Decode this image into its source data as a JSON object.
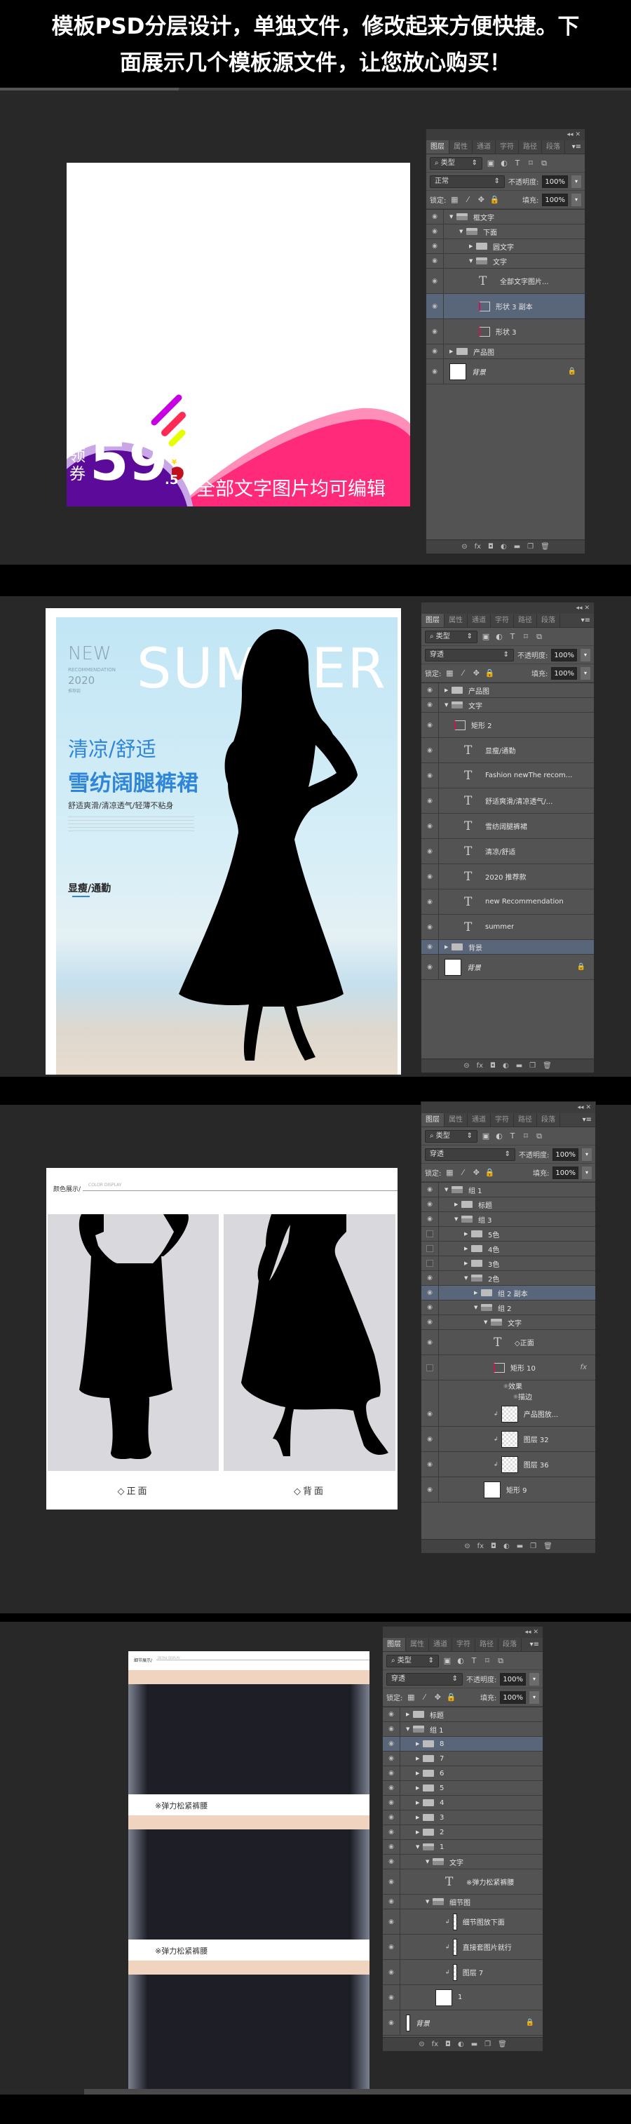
{
  "header": {
    "line1": "模板PSD分层设计，单独文件，修改起来方便快捷。下",
    "line2": "面展示几个模板源文件，让您放心购买！"
  },
  "colors": {
    "purple": "#5b0a9a",
    "pink": "#ff2a7a",
    "blue_text": "#2f86d8",
    "panel": "#535353",
    "selected_row": "#596578",
    "page_bg": "#282828"
  },
  "panel_common": {
    "collapse": "◂◂",
    "close": "✕",
    "tabs": [
      "图层",
      "属性",
      "通道",
      "字符",
      "路径",
      "段落"
    ],
    "menu": "▾≡",
    "filter_label": "⌕ 类型",
    "opacity_label": "不透明度:",
    "opacity": "100%",
    "lock_label": "锁定:",
    "fill_label": "填充:",
    "fill": "100%",
    "bottom_icons": [
      "⊝",
      "fx",
      "◘",
      "◐",
      "▬",
      "❐",
      "🗑"
    ]
  },
  "panels": [
    {
      "blend": "正常",
      "layers": [
        {
          "name": "框文字",
          "indent": 0,
          "type": "folder-open"
        },
        {
          "name": "下面",
          "indent": 1,
          "type": "folder-open"
        },
        {
          "name": "圆文字",
          "indent": 2,
          "type": "folder"
        },
        {
          "name": "文字",
          "indent": 2,
          "type": "folder-open"
        },
        {
          "name": "全部文字图片...",
          "indent": 3,
          "type": "text",
          "tall": true
        },
        {
          "name": "形状 3 副本",
          "indent": 3,
          "type": "shape",
          "tall": true,
          "selected": true
        },
        {
          "name": "形状 3",
          "indent": 3,
          "type": "shape",
          "tall": true
        },
        {
          "name": "产品图",
          "indent": 0,
          "type": "folder"
        },
        {
          "name": "背景",
          "indent": 0,
          "type": "thumb-white",
          "tall": true,
          "italic": true,
          "locked": true
        }
      ]
    },
    {
      "blend": "穿透",
      "layers": [
        {
          "name": "产品图",
          "indent": 0,
          "type": "folder"
        },
        {
          "name": "文字",
          "indent": 0,
          "type": "folder-open"
        },
        {
          "name": "矩形 2",
          "indent": 1,
          "type": "shape",
          "tall": true
        },
        {
          "name": "显瘦/通勤",
          "indent": 2,
          "type": "text",
          "tall": true
        },
        {
          "name": "Fashion newThe recom...",
          "indent": 2,
          "type": "text",
          "tall": true
        },
        {
          "name": "舒适爽滑/清凉透气/...",
          "indent": 2,
          "type": "text",
          "tall": true
        },
        {
          "name": "雪纺阔腿裤裙",
          "indent": 2,
          "type": "text",
          "tall": true
        },
        {
          "name": "清凉/舒适",
          "indent": 2,
          "type": "text",
          "tall": true
        },
        {
          "name": "2020 推荐款",
          "indent": 2,
          "type": "text",
          "tall": true
        },
        {
          "name": "new Recommendation",
          "indent": 2,
          "type": "text",
          "tall": true
        },
        {
          "name": "summer",
          "indent": 2,
          "type": "text",
          "tall": true
        },
        {
          "name": "背景",
          "indent": 0,
          "type": "folder",
          "selected": true
        },
        {
          "name": "背景",
          "indent": 0,
          "type": "thumb-white",
          "tall": true,
          "italic": true,
          "locked": true
        }
      ]
    },
    {
      "blend": "穿透",
      "layers": [
        {
          "name": "组 1",
          "indent": 0,
          "type": "folder-open"
        },
        {
          "name": "标题",
          "indent": 1,
          "type": "folder"
        },
        {
          "name": "组 3",
          "indent": 1,
          "type": "folder-open"
        },
        {
          "name": "5色",
          "indent": 2,
          "type": "folder",
          "hidden": true
        },
        {
          "name": "4色",
          "indent": 2,
          "type": "folder",
          "hidden": true
        },
        {
          "name": "3色",
          "indent": 2,
          "type": "folder",
          "hidden": true
        },
        {
          "name": "2色",
          "indent": 2,
          "type": "folder-open"
        },
        {
          "name": "组 2 副本",
          "indent": 3,
          "type": "folder",
          "selected": true
        },
        {
          "name": "组 2",
          "indent": 3,
          "type": "folder-open"
        },
        {
          "name": "文字",
          "indent": 4,
          "type": "folder-open"
        },
        {
          "name": "◇正面",
          "indent": 5,
          "type": "text",
          "tall": true
        },
        {
          "name": "矩形 10",
          "indent": 5,
          "type": "shape",
          "tall": true,
          "hidden": true,
          "fx": "fx"
        },
        {
          "name": "效果",
          "indent": 6,
          "type": "effect"
        },
        {
          "name": "描边",
          "indent": 7,
          "type": "effect"
        },
        {
          "name": "产品图放...",
          "indent": 5,
          "type": "thumb",
          "tall": true,
          "clip": true
        },
        {
          "name": "图层 32",
          "indent": 5,
          "type": "thumb",
          "tall": true,
          "clip": true
        },
        {
          "name": "图层 36",
          "indent": 5,
          "type": "thumb",
          "tall": true,
          "clip": true
        },
        {
          "name": "矩形 9",
          "indent": 4,
          "type": "thumb-white",
          "tall": true
        }
      ]
    },
    {
      "blend": "穿透",
      "layers": [
        {
          "name": "标题",
          "indent": 0,
          "type": "folder"
        },
        {
          "name": "组 1",
          "indent": 0,
          "type": "folder-open"
        },
        {
          "name": "8",
          "indent": 1,
          "type": "folder",
          "selected": true
        },
        {
          "name": "7",
          "indent": 1,
          "type": "folder"
        },
        {
          "name": "6",
          "indent": 1,
          "type": "folder"
        },
        {
          "name": "5",
          "indent": 1,
          "type": "folder"
        },
        {
          "name": "4",
          "indent": 1,
          "type": "folder"
        },
        {
          "name": "3",
          "indent": 1,
          "type": "folder"
        },
        {
          "name": "2",
          "indent": 1,
          "type": "folder"
        },
        {
          "name": "1",
          "indent": 1,
          "type": "folder-open"
        },
        {
          "name": "文字",
          "indent": 2,
          "type": "folder-open"
        },
        {
          "name": "※弹力松紧裤腰",
          "indent": 4,
          "type": "text",
          "tall": true
        },
        {
          "name": "细节图",
          "indent": 2,
          "type": "folder-open"
        },
        {
          "name": "细节图放下面",
          "indent": 4,
          "type": "thumb-slim",
          "tall": true,
          "clip": true
        },
        {
          "name": "直接套图片就行",
          "indent": 4,
          "type": "thumb-slim",
          "tall": true,
          "clip": true
        },
        {
          "name": "图层 7",
          "indent": 4,
          "type": "thumb-slim",
          "tall": true,
          "clip": true
        },
        {
          "name": "1",
          "indent": 3,
          "type": "thumb-white",
          "tall": true
        },
        {
          "name": "背景",
          "indent": 0,
          "type": "thumb-slim-white",
          "tall": true,
          "italic": true,
          "locked": true
        }
      ]
    }
  ],
  "canvas1": {
    "coupon_label": "领券",
    "price": "59",
    "price_decimal": ".5",
    "currency": "¥",
    "banner_text": "全部文字图片均可编辑"
  },
  "canvas2": {
    "new": "NEW",
    "recommendation": "RECOMMENDATION",
    "year": "2020",
    "recommend_tag": "推荐款",
    "summer": "SUMMER",
    "title1": "清凉/舒适",
    "title2": "雪纺阔腿裤裙",
    "subtitle": "舒适爽滑/清凉透气/轻薄不粘身",
    "tag": "显瘦/通勤"
  },
  "canvas3": {
    "section_title": "颜色展示/",
    "section_en": "COLOR DISPLAY",
    "front": "◇正面",
    "back": "◇背面"
  },
  "canvas4": {
    "section_title": "细节展示/",
    "section_en": "DETAIL DISPLAY",
    "captions": [
      "※弹力松紧裤腰",
      "※弹力松紧裤腰"
    ]
  }
}
